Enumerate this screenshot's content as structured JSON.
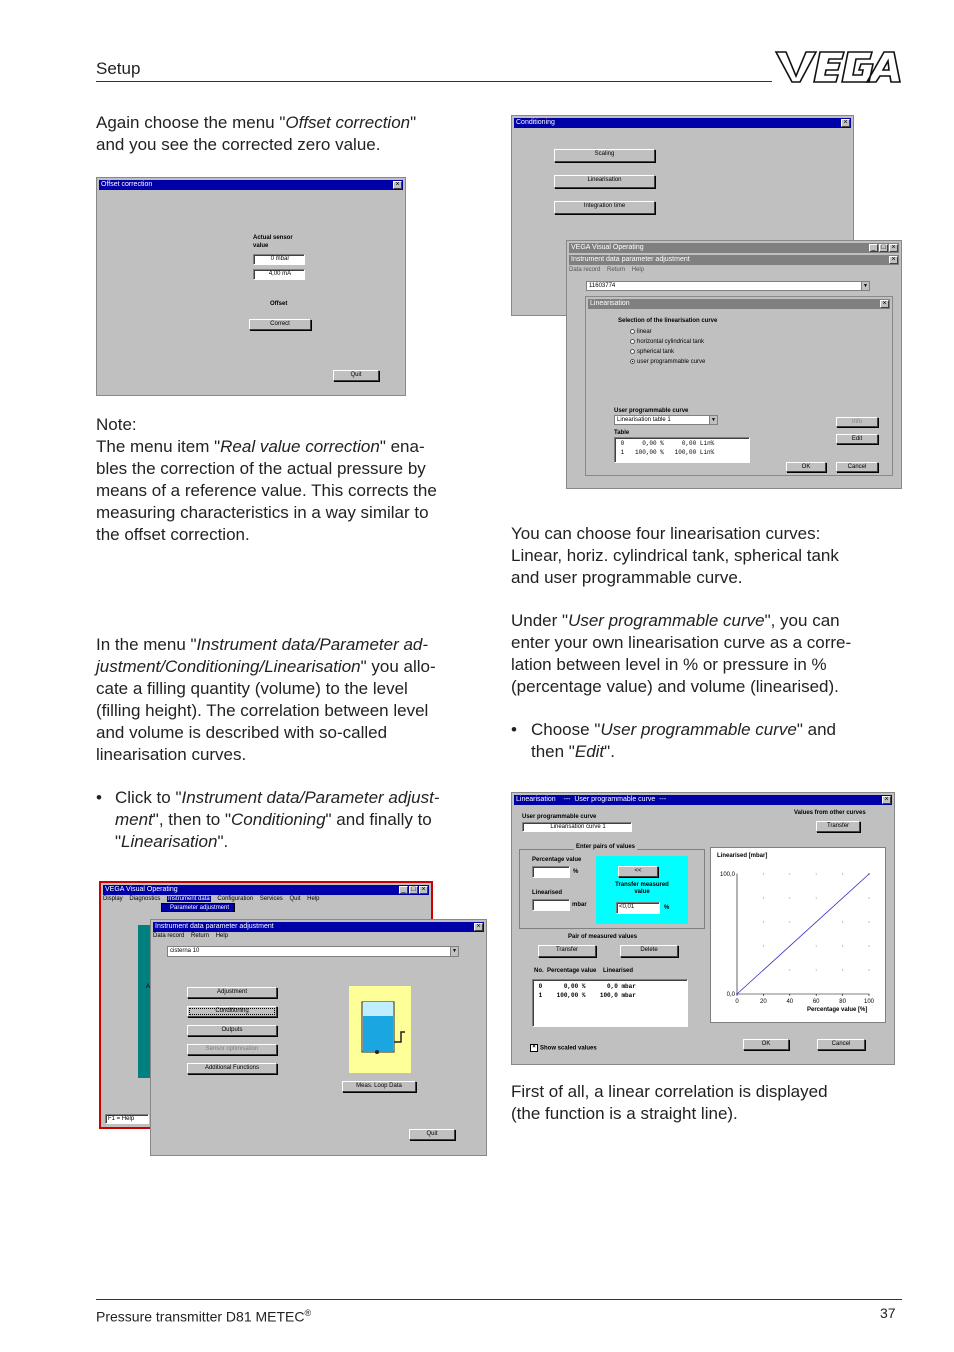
{
  "header": {
    "section": "Setup",
    "logo_text": "VEGA"
  },
  "footer": {
    "product": "Pressure transmitter D81 METEC",
    "reg": "®",
    "page": "37"
  },
  "col_left": {
    "p1_a": "Again choose the menu \"",
    "p1_em": "Offset correction",
    "p1_b": "\"",
    "p1_line2": "and you see the corrected zero value.",
    "note_label": "Note:",
    "note_a": "The menu item \"",
    "note_em": "Real value correction",
    "note_b": "\" ena-",
    "note_l2": "bles the correction of the actual pressure by",
    "note_l3": "means of a reference value. This corrects the",
    "note_l4": "measuring characteristics in a way similar to",
    "note_l5": "the offset correction.",
    "p3_a": "In the menu \"",
    "p3_em1": "Instrument data/Parameter ad-",
    "p3_em2": "justment/Conditioning/Linearisation",
    "p3_b": "\" you allo-",
    "p3_l3": "cate a filling quantity (volume) to the level",
    "p3_l4": "(filling height). The correlation between level",
    "p3_l5": "and volume is described with so-called",
    "p3_l6": "linearisation curves.",
    "b1_a": "Click to \"",
    "b1_em1": "Instrument data/Parameter adjust-",
    "b1_em2": "ment",
    "b1_b": "\", then to \"",
    "b1_em3": "Conditioning",
    "b1_c": "\" and finally to",
    "b1_d": "\"",
    "b1_em4": "Linearisation",
    "b1_e": "\"."
  },
  "col_right": {
    "p1_l1": "You can choose four linearisation curves:",
    "p1_l2": "Linear, horiz. cylindrical tank, spherical tank",
    "p1_l3": "and user programmable curve.",
    "p2_a": "Under \"",
    "p2_em": "User programmable curve",
    "p2_b": "\", you can",
    "p2_l2": "enter your own linearisation curve as a corre-",
    "p2_l3": "lation between level in % or pressure in %",
    "p2_l4": "(percentage value) and volume (linearised).",
    "b_a": "Choose \"",
    "b_em": "User programmable curve",
    "b_b": "\" and",
    "b_c": "then \"",
    "b_em2": "Edit",
    "b_d": "\".",
    "p3_l1": "First of all, a linear correlation is displayed",
    "p3_l2": "(the function is a straight line)."
  },
  "offset_win": {
    "title": "Offset correction",
    "sensor_label_1": "Actual sensor",
    "sensor_label_2": "value",
    "value_mbar": "0 mbar",
    "value_ma": "4,00 mA",
    "offset_label": "Offset",
    "correct_btn": "Correct",
    "quit_btn": "Quit"
  },
  "cond_win": {
    "title": "Conditioning",
    "scaling_btn": "Scaling",
    "lin_btn": "Linearisation",
    "integ_btn": "Integration time"
  },
  "vvo_win": {
    "title": "VEGA Visual Operating",
    "sub_title": "Instrument data parameter adjustment",
    "menu": [
      "Data record",
      "Return",
      "Help"
    ],
    "device_value": "11603774",
    "lin_title": "Linearisation",
    "selection_label": "Selection of the linearisation curve",
    "options": [
      "linear",
      "horizontal cylindrical tank",
      "spherical tank",
      "user programmable curve"
    ],
    "selected_index": 3,
    "upc_label": "User programmable curve",
    "upc_value": "Linearisation table 1",
    "table_label": "Table",
    "table_rows": [
      {
        "n": "0",
        "pct": "0,00 %",
        "lin": "0,00 Lin%"
      },
      {
        "n": "1",
        "pct": "100,00 %",
        "lin": "100,00 Lin%"
      }
    ],
    "info_btn": "Info",
    "edit_btn": "Edit",
    "ok_btn": "OK",
    "cancel_btn": "Cancel"
  },
  "main_win": {
    "title": "VEGA Visual Operating",
    "menu": [
      "Display",
      "Diagnostics",
      "Instrument data",
      "Configuration",
      "Services",
      "Quit",
      "Help"
    ],
    "submenu": "Parameter adjustment",
    "status": "F1 = Help",
    "inner_title": "Instrument data parameter adjustment",
    "inner_menu": [
      "Data record",
      "Return",
      "Help"
    ],
    "device_value": "cisterna 10",
    "buttons": [
      "Adjustment",
      "Conditioning",
      "Outputs",
      "Sensor optimisation",
      "Additional Functions"
    ],
    "meas_btn": "Meas. Loop Data",
    "quit_btn": "Quit",
    "side_text": "A"
  },
  "upc_win": {
    "title": "Linearisation",
    "title_sep": "---",
    "title_mode": "User programmable curve",
    "upc_label": "User programmable curve",
    "upc_value": "Linearisation curve 1",
    "other_label": "Values from other curves",
    "transfer_top": "Transfer",
    "enter_pairs": "Enter pairs of values",
    "pct_label": "Percentage value",
    "pct_unit": "%",
    "lin_label": "Linearised",
    "lin_unit": "mbar",
    "arrow_btn": "<<",
    "transfer_meas_1": "Transfer measured",
    "transfer_meas_2": "value",
    "meas_value": "<0,01",
    "meas_unit": "%",
    "pair_label": "Pair of measured values",
    "transfer_btn": "Transfer",
    "delete_btn": "Delete",
    "table_header": "No.  Percentage value    Linearised",
    "rows": [
      {
        "n": "0",
        "pct": "0,00 %",
        "lin": "0,0 mbar"
      },
      {
        "n": "1",
        "pct": "100,00 %",
        "lin": "100,0 mbar"
      }
    ],
    "show_scaled": "Show scaled values",
    "ok_btn": "OK",
    "cancel_btn": "Cancel",
    "chart_title": "Linearised [mbar]",
    "chart_xlabel": "Percentage value [%]"
  },
  "chart_data": {
    "type": "line",
    "title": "Linearised [mbar]",
    "xlabel": "Percentage value [%]",
    "ylabel": "Linearised [mbar]",
    "x": [
      0,
      100
    ],
    "series": [
      {
        "values": [
          0,
          100
        ]
      }
    ],
    "xlim": [
      0,
      100
    ],
    "ylim": [
      0,
      100
    ],
    "x_ticks": [
      "0",
      "20",
      "40",
      "60",
      "80",
      "100"
    ],
    "y_ticks": [
      "0,0",
      "100,0"
    ],
    "grid": true,
    "line_color": "#3030c0"
  },
  "colors": {
    "title_bar": "#0000a8",
    "window_face": "#c0c0c0",
    "teal": "#008080",
    "cyan_panel": "#00ffff",
    "tank_bg": "#ffff99",
    "red_frame": "#cc0000"
  }
}
